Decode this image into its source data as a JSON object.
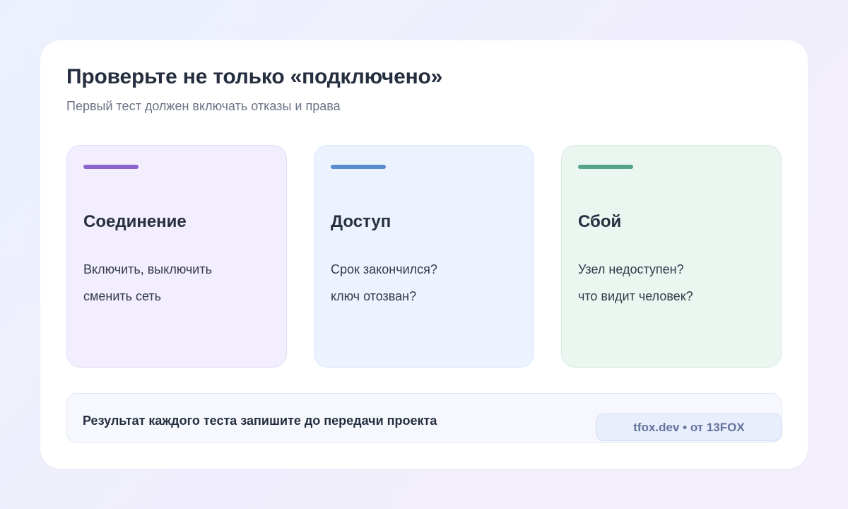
{
  "header": {
    "title": "Проверьте не только «подключено»",
    "subtitle": "Первый тест должен включать отказы и права"
  },
  "panels": [
    {
      "title": "Соединение",
      "lines": [
        "Включить, выключить",
        "сменить сеть"
      ],
      "accent": "#8b63cc",
      "background": "#f2eefd"
    },
    {
      "title": "Доступ",
      "lines": [
        "Срок закончился?",
        "ключ отозван?"
      ],
      "accent": "#5b8ccf",
      "background": "#edf3fe"
    },
    {
      "title": "Сбой",
      "lines": [
        "Узел недоступен?",
        "что видит человек?"
      ],
      "accent": "#53a48a",
      "background": "#ecf6f1"
    }
  ],
  "footer": {
    "text": "Результат каждого теста запишите до передачи проекта",
    "badge": "tfox.dev • от 13FOX"
  }
}
